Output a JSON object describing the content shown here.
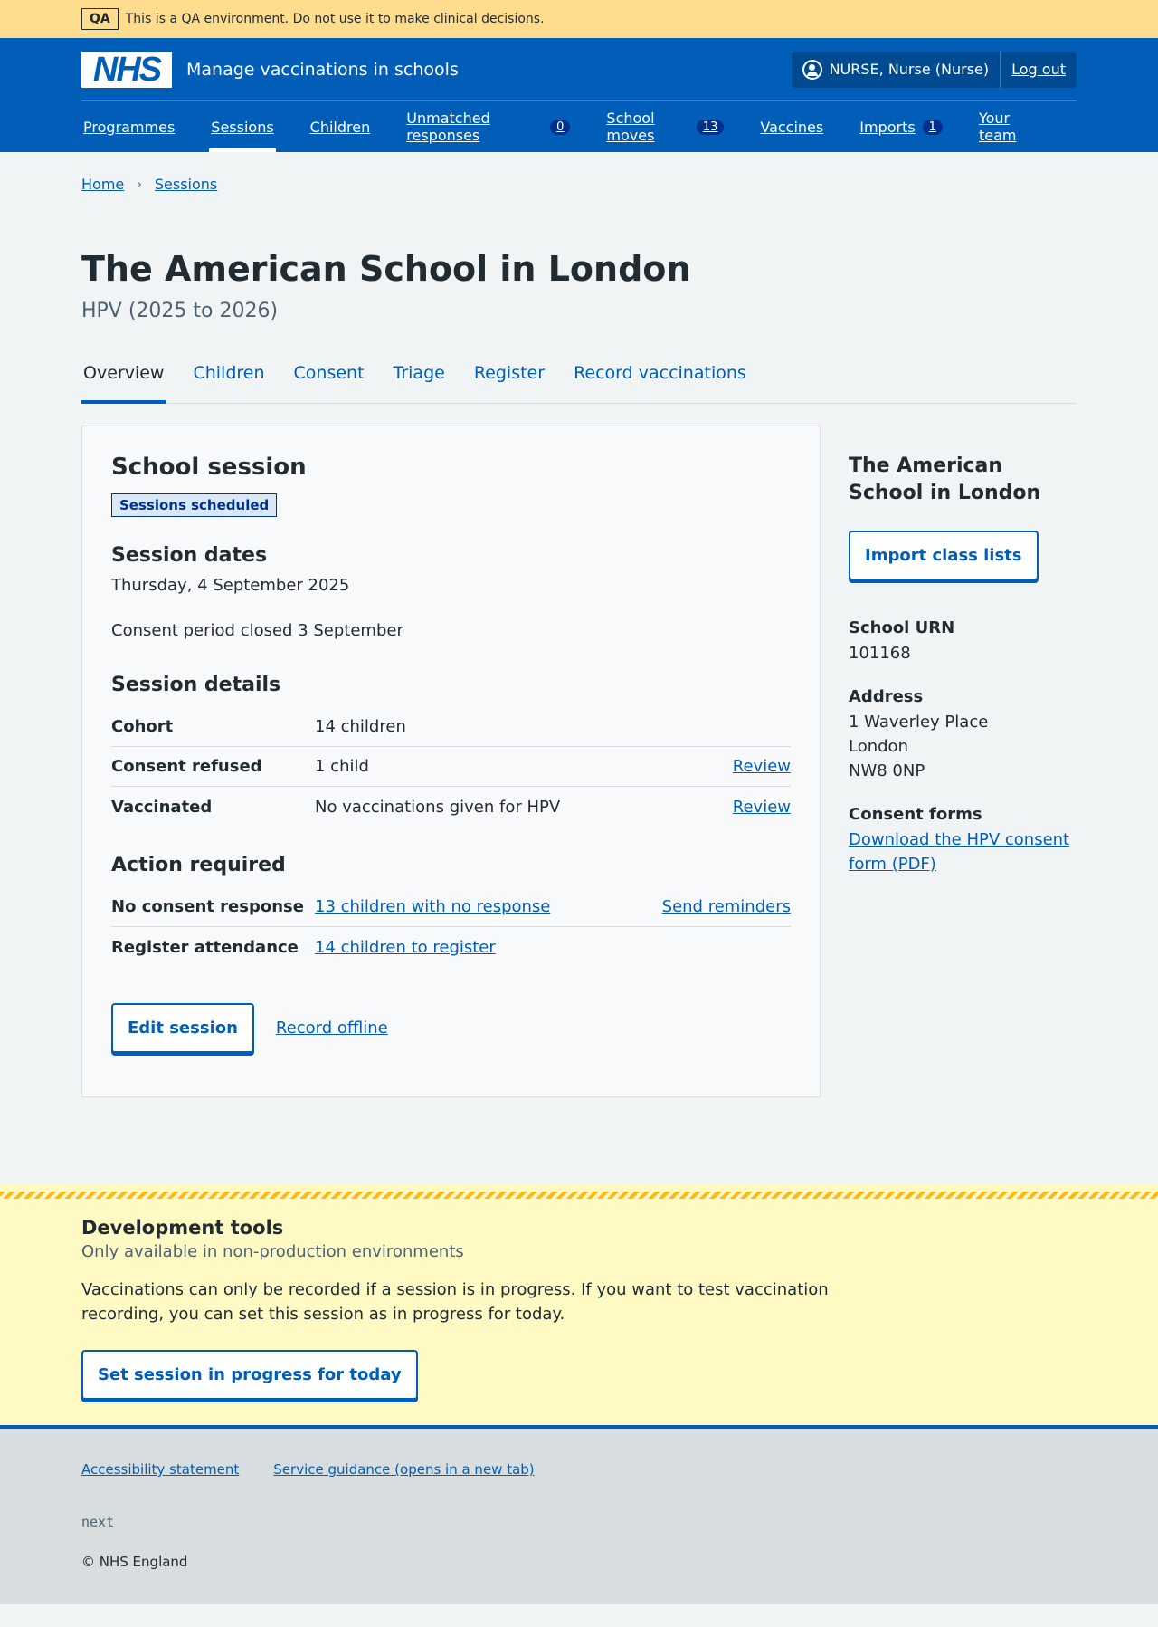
{
  "qa_banner": {
    "tag": "QA",
    "text": "This is a QA environment. Do not use it to make clinical decisions."
  },
  "header": {
    "logo": "NHS",
    "service_name": "Manage vaccinations in schools",
    "user": "NURSE, Nurse (Nurse)",
    "logout": "Log out",
    "nav": [
      {
        "label": "Programmes"
      },
      {
        "label": "Sessions"
      },
      {
        "label": "Children"
      },
      {
        "label": "Unmatched responses",
        "count": "0"
      },
      {
        "label": "School moves",
        "count": "13"
      },
      {
        "label": "Vaccines"
      },
      {
        "label": "Imports",
        "count": "1"
      },
      {
        "label": "Your team"
      }
    ]
  },
  "breadcrumb": [
    "Home",
    "Sessions"
  ],
  "page": {
    "title": "The American School in London",
    "caption": "HPV (2025 to 2026)"
  },
  "tabs": [
    "Overview",
    "Children",
    "Consent",
    "Triage",
    "Register",
    "Record vaccinations"
  ],
  "session": {
    "heading": "School session",
    "status": "Sessions scheduled",
    "dates_heading": "Session dates",
    "date": "Thursday, 4 September 2025",
    "consent_period": "Consent period closed 3 September",
    "details_heading": "Session details",
    "details": [
      {
        "key": "Cohort",
        "value": "14 children",
        "action": ""
      },
      {
        "key": "Consent refused",
        "value": "1 child",
        "action": "Review"
      },
      {
        "key": "Vaccinated",
        "value": "No vaccinations given for HPV",
        "action": "Review"
      }
    ],
    "action_heading": "Action required",
    "actions": [
      {
        "key": "No consent response",
        "value": "13 children with no response",
        "action": "Send reminders"
      },
      {
        "key": "Register attendance",
        "value": "14 children to register",
        "action": ""
      }
    ],
    "edit_button": "Edit session",
    "record_offline": "Record offline"
  },
  "sidebar": {
    "title": "The American School in London",
    "import_button": "Import class lists",
    "urn_label": "School URN",
    "urn": "101168",
    "address_label": "Address",
    "address": [
      "1 Waverley Place",
      "London",
      "NW8 0NP"
    ],
    "consent_label": "Consent forms",
    "consent_link": "Download the HPV consent form (PDF)"
  },
  "devtools": {
    "heading": "Development tools",
    "sub": "Only available in non-production environments",
    "description": "Vaccinations can only be recorded if a session is in progress. If you want to test vaccination recording, you can set this session as in progress for today.",
    "button": "Set session in progress for today"
  },
  "footer": {
    "links": [
      "Accessibility statement",
      "Service guidance (opens in a new tab)"
    ],
    "version": "next",
    "copyright": "© NHS England"
  },
  "colors": {
    "brand": "#005eb8",
    "qa": "#ffdc8e",
    "devtools": "#fff9c4"
  }
}
